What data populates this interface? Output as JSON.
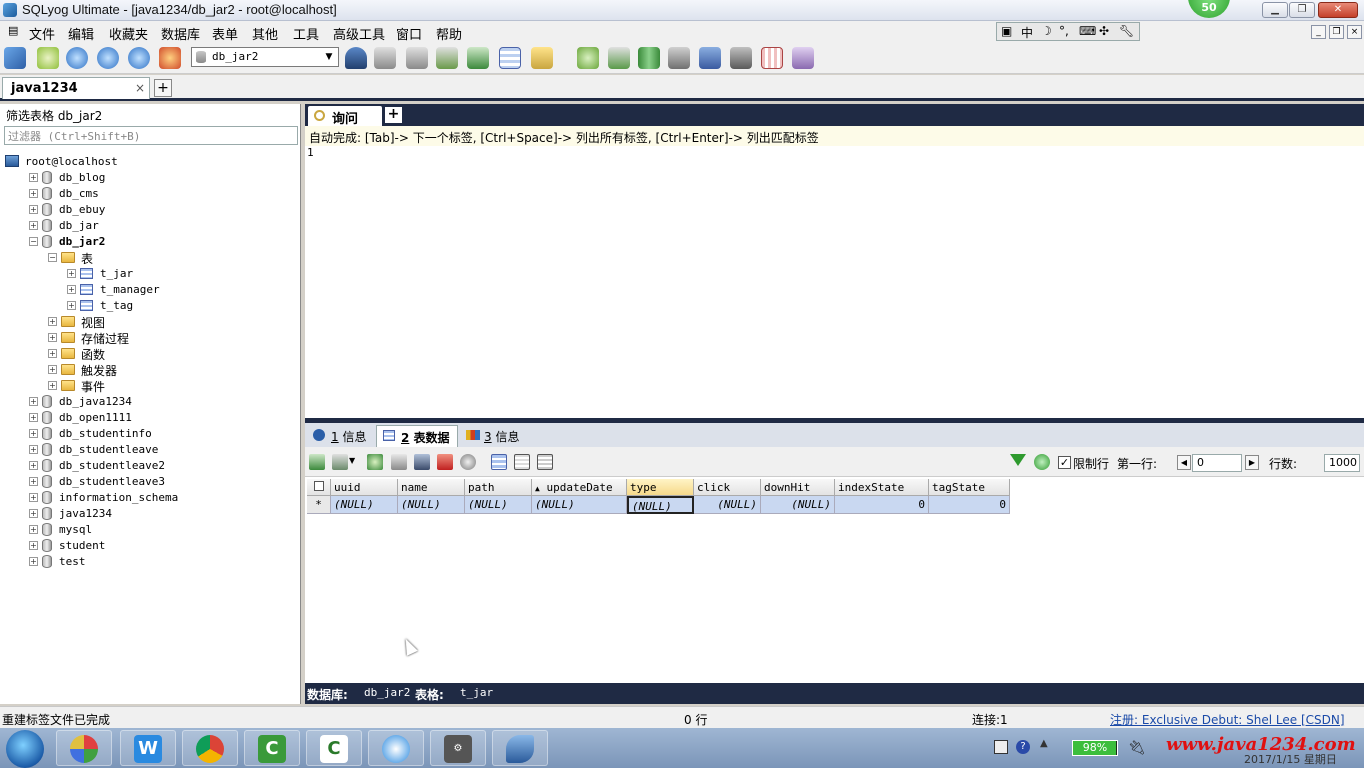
{
  "window": {
    "title": "SQLyog Ultimate - [java1234/db_jar2 - root@localhost]",
    "badge": "50"
  },
  "menu": [
    "文件",
    "编辑",
    "收藏夹",
    "数据库",
    "表单",
    "其他",
    "工具",
    "高级工具",
    "窗口",
    "帮助"
  ],
  "ime": {
    "cn": "中"
  },
  "toolbar": {
    "database_selected": "db_jar2"
  },
  "connection_tabs": [
    {
      "label": "java1234",
      "close": "×"
    }
  ],
  "left_panel": {
    "filter_label": "筛选表格 db_jar2",
    "filter_placeholder": "过滤器 (Ctrl+Shift+B)",
    "tree": [
      {
        "label": "root@localhost",
        "type": "server",
        "level": 0
      },
      {
        "label": "db_blog",
        "type": "db",
        "level": 1,
        "exp": "+"
      },
      {
        "label": "db_cms",
        "type": "db",
        "level": 1,
        "exp": "+"
      },
      {
        "label": "db_ebuy",
        "type": "db",
        "level": 1,
        "exp": "+"
      },
      {
        "label": "db_jar",
        "type": "db",
        "level": 1,
        "exp": "+"
      },
      {
        "label": "db_jar2",
        "type": "db",
        "level": 1,
        "exp": "−",
        "bold": true
      },
      {
        "label": "表",
        "type": "folder",
        "level": 2,
        "exp": "−"
      },
      {
        "label": "t_jar",
        "type": "table",
        "level": 3,
        "exp": "+"
      },
      {
        "label": "t_manager",
        "type": "table",
        "level": 3,
        "exp": "+"
      },
      {
        "label": "t_tag",
        "type": "table",
        "level": 3,
        "exp": "+"
      },
      {
        "label": "视图",
        "type": "folder",
        "level": 2,
        "exp": "+"
      },
      {
        "label": "存储过程",
        "type": "folder",
        "level": 2,
        "exp": "+"
      },
      {
        "label": "函数",
        "type": "folder",
        "level": 2,
        "exp": "+"
      },
      {
        "label": "触发器",
        "type": "folder",
        "level": 2,
        "exp": "+"
      },
      {
        "label": "事件",
        "type": "folder",
        "level": 2,
        "exp": "+"
      },
      {
        "label": "db_java1234",
        "type": "db",
        "level": 1,
        "exp": "+"
      },
      {
        "label": "db_open1111",
        "type": "db",
        "level": 1,
        "exp": "+"
      },
      {
        "label": "db_studentinfo",
        "type": "db",
        "level": 1,
        "exp": "+"
      },
      {
        "label": "db_studentleave",
        "type": "db",
        "level": 1,
        "exp": "+"
      },
      {
        "label": "db_studentleave2",
        "type": "db",
        "level": 1,
        "exp": "+"
      },
      {
        "label": "db_studentleave3",
        "type": "db",
        "level": 1,
        "exp": "+"
      },
      {
        "label": "information_schema",
        "type": "db",
        "level": 1,
        "exp": "+"
      },
      {
        "label": "java1234",
        "type": "db",
        "level": 1,
        "exp": "+"
      },
      {
        "label": "mysql",
        "type": "db",
        "level": 1,
        "exp": "+"
      },
      {
        "label": "student",
        "type": "db",
        "level": 1,
        "exp": "+"
      },
      {
        "label": "test",
        "type": "db",
        "level": 1,
        "exp": "+"
      }
    ]
  },
  "query": {
    "tab_label": "询问",
    "add_tab": "+",
    "hint": "自动完成: [Tab]-> 下一个标签, [Ctrl+Space]-> 列出所有标签, [Ctrl+Enter]-> 列出匹配标签",
    "line_number": "1"
  },
  "result_tabs": [
    {
      "num": "1",
      "label": " 信息"
    },
    {
      "num": "2",
      "label": " 表数据"
    },
    {
      "num": "3",
      "label": " 信息"
    }
  ],
  "result_toolbar": {
    "limit_label": "限制行",
    "limit_checked": "✓",
    "first_row_label": "第一行:",
    "first_row_value": "0",
    "rows_label": "行数:",
    "rows_value": "1000",
    "prev": "◀",
    "next": "▶"
  },
  "grid": {
    "sort_glyph": "▲",
    "columns": [
      "uuid",
      "name",
      "path",
      "updateDate",
      "type",
      "click",
      "downHit",
      "indexState",
      "tagState"
    ],
    "row_marker": "*",
    "row": [
      "(NULL)",
      "(NULL)",
      "(NULL)",
      "(NULL)",
      "(NULL)",
      "(NULL)",
      "(NULL)",
      "0",
      "0"
    ]
  },
  "info_bar": {
    "db_label": "数据库:",
    "db_value": "db_jar2",
    "table_label": "表格:",
    "table_value": "t_jar"
  },
  "status_bar": {
    "message": "重建标签文件已完成",
    "rows": "0 行",
    "connection": "连接:1",
    "register": "注册: Exclusive Debut: Shel Lee [CSDN]"
  },
  "taskbar": {
    "battery": "98%",
    "battery_level": 0.98,
    "watermark": "www.java1234.com",
    "date": "2017/1/15 星期日"
  }
}
